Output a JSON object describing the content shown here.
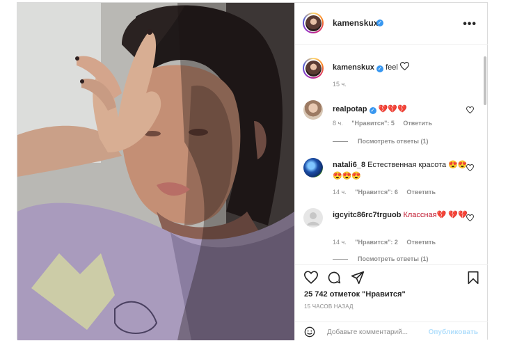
{
  "post": {
    "username": "kamenskux",
    "caption": "feel",
    "caption_time": "15 ч.",
    "likes": "25 742 отметок \"Нравится\"",
    "time_ago": "15 ЧАСОВ НАЗАД"
  },
  "comments": [
    {
      "username": "realpotap",
      "verified": true,
      "text": "💔💔💔",
      "time": "8 ч.",
      "likes": "\"Нравится\": 5",
      "reply": "Ответить",
      "view_replies": "Посмотреть ответы (1)"
    },
    {
      "username": "natali6_8",
      "verified": false,
      "text": "Естественная красота 😍😍😍😍😍",
      "time": "14 ч.",
      "likes": "\"Нравится\": 6",
      "reply": "Ответить",
      "view_replies": ""
    },
    {
      "username": "igcyitc86rc7trguob",
      "verified": false,
      "text": "Классная💔 💔💔",
      "time": "14 ч.",
      "likes": "\"Нравится\": 2",
      "reply": "Ответить",
      "view_replies": "Посмотреть ответы (1)"
    }
  ],
  "add_comment": {
    "placeholder": "Добавьте комментарий...",
    "publish": "Опубликовать"
  },
  "icons": [
    "more-options-icon",
    "heart-icon",
    "comment-icon",
    "share-icon",
    "bookmark-icon",
    "emoji-icon"
  ],
  "colors": {
    "verified": "#3897f0",
    "publish": "#b2dffc",
    "meta": "#8e8e8e"
  }
}
